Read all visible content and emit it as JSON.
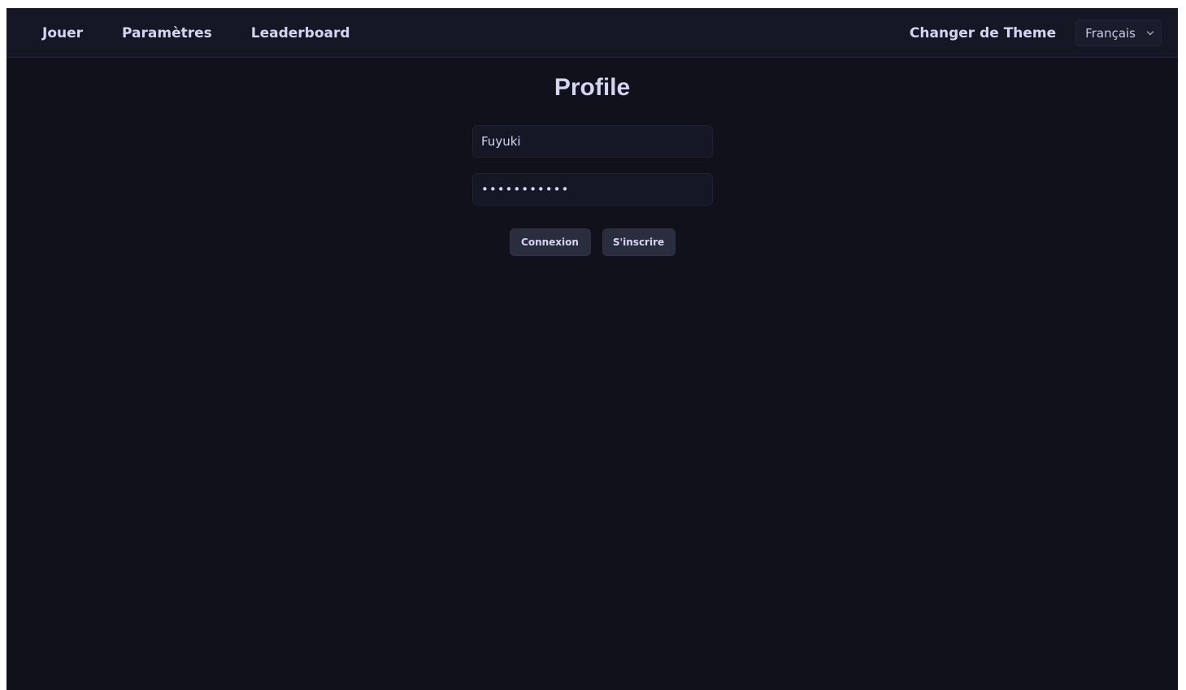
{
  "navbar": {
    "links": [
      {
        "label": "Jouer"
      },
      {
        "label": "Paramètres"
      },
      {
        "label": "Leaderboard"
      }
    ],
    "theme_label": "Changer de Theme",
    "language": {
      "selected": "Français"
    }
  },
  "main": {
    "title": "Profile",
    "username": {
      "value": "Fuyuki"
    },
    "password": {
      "value": "Fuyuki12345"
    },
    "buttons": {
      "login_label": "Connexion",
      "register_label": "S'inscrire"
    }
  },
  "colors": {
    "background": "#10111a",
    "navbar": "#161725",
    "text": "#d3d6f2",
    "button": "#2a2d3e"
  }
}
